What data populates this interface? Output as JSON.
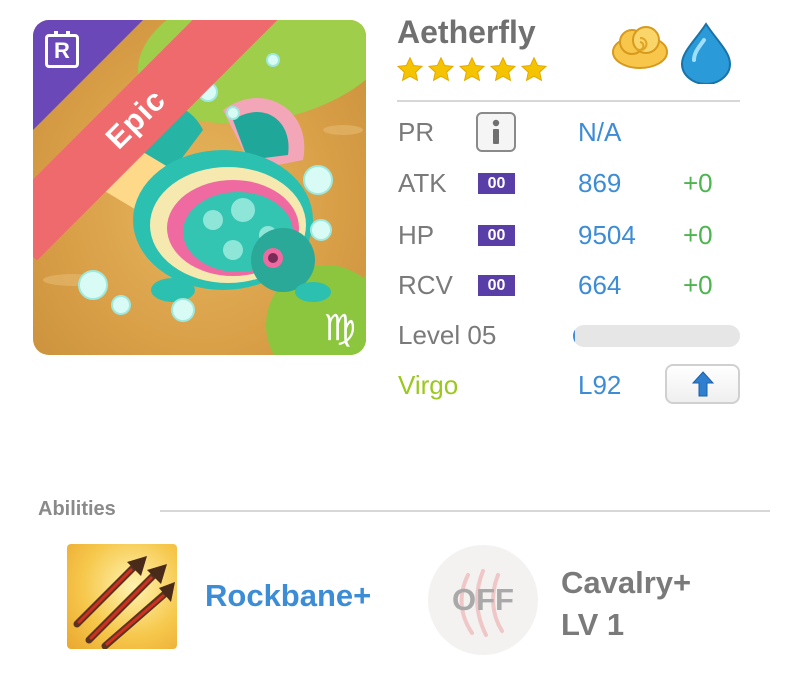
{
  "monster": {
    "name": "Aetherfly",
    "star_count": 5,
    "rarity_label": "Epic",
    "rarity_badge": "R",
    "zodiac_glyph": "♍",
    "element_icons": [
      "cloud-icon",
      "water-drop-icon"
    ]
  },
  "stats": {
    "pr": {
      "label": "PR",
      "value": "N/A"
    },
    "atk": {
      "label": "ATK",
      "plus": "00",
      "value": "869",
      "bonus": "+0"
    },
    "hp": {
      "label": "HP",
      "plus": "00",
      "value": "9504",
      "bonus": "+0"
    },
    "rcv": {
      "label": "RCV",
      "plus": "00",
      "value": "664",
      "bonus": "+0"
    },
    "level": {
      "label": "Level 05",
      "progress": 0.01
    },
    "zodiac": {
      "label": "Virgo",
      "value": "L92"
    }
  },
  "abilities": {
    "title": "Abilities",
    "items": [
      {
        "name": "Rockbane+",
        "icon": "arrows-icon"
      },
      {
        "name_line1": "Cavalry+",
        "name_line2": "LV 1",
        "status": "OFF",
        "icon": "claw-icon"
      }
    ]
  },
  "colors": {
    "name": "#707070",
    "value_blue": "#3d8cd6",
    "bonus_green": "#4db54d",
    "badge_purple": "#5a3ea8",
    "zodiac_green": "#9bc81e",
    "ribbon_red": "#ee6a6c",
    "star_yellow": "#f5c400"
  }
}
